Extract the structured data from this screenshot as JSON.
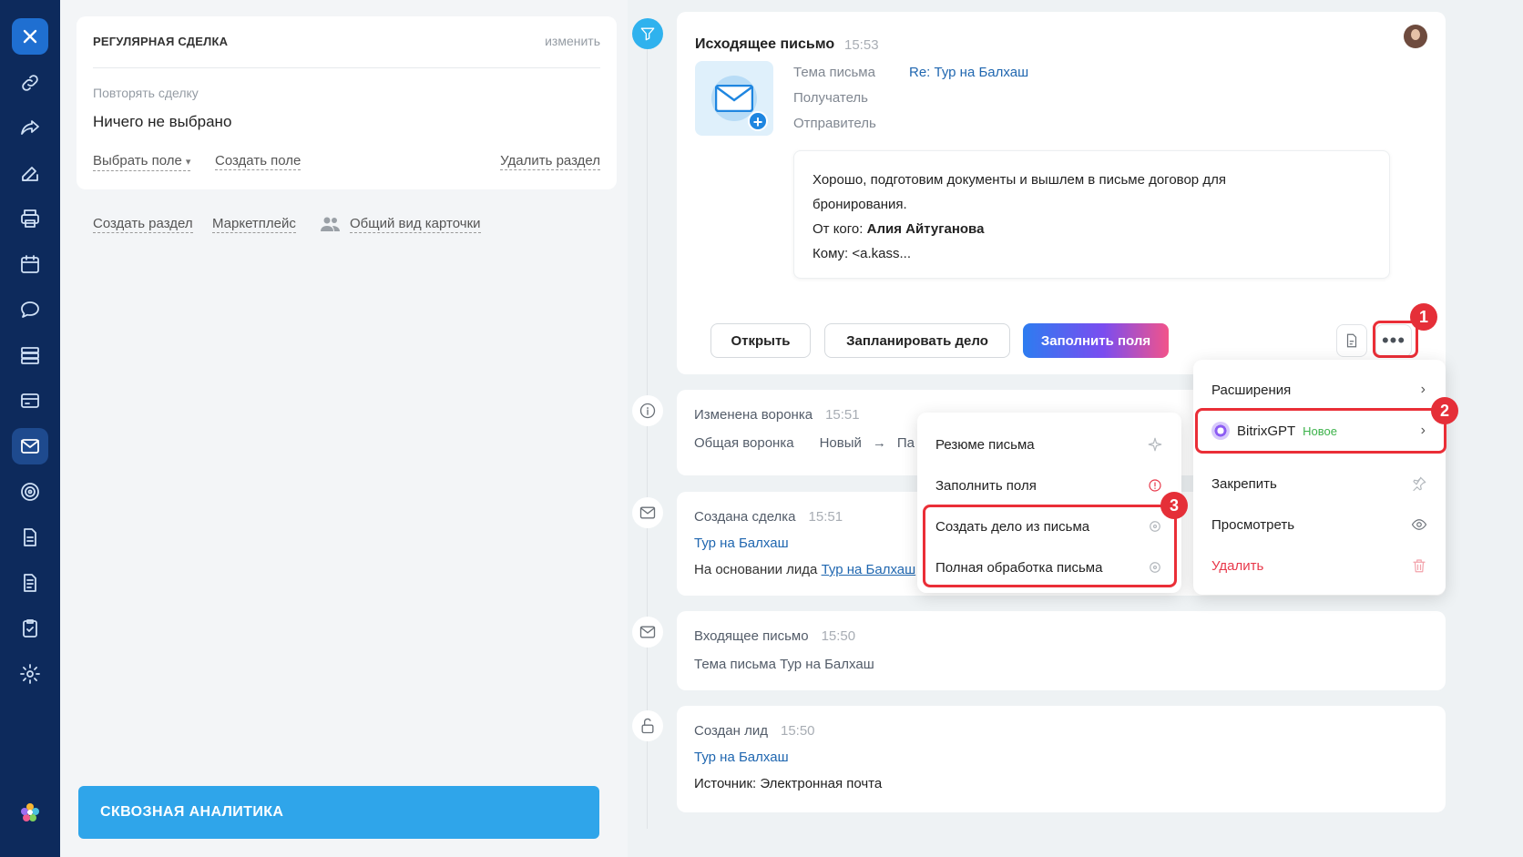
{
  "sidebar": {
    "icons": [
      "close-icon",
      "link-icon",
      "share-icon",
      "edit-icon",
      "print-icon",
      "calendar-icon",
      "chat-icon",
      "list-icon",
      "card-icon",
      "mail-icon",
      "target-icon",
      "document-icon",
      "document-lines-icon",
      "clipboard-check-icon",
      "gear-icon",
      "flower-logo-icon"
    ]
  },
  "left": {
    "section_title": "РЕГУЛЯРНАЯ СДЕЛКА",
    "change_label": "изменить",
    "repeat_label": "Повторять сделку",
    "repeat_value": "Ничего не выбрано",
    "choose_field": "Выбрать поле",
    "create_field": "Создать поле",
    "delete_section": "Удалить раздел",
    "create_section": "Создать раздел",
    "marketplace": "Маркетплейс",
    "card_view": "Общий вид карточки",
    "analytics_button": "СКВОЗНАЯ АНАЛИТИКА"
  },
  "email": {
    "title": "Исходящее письмо",
    "time": "15:53",
    "subject_label": "Тема письма",
    "subject_value": "Re: Тур на Балхаш",
    "recipient_label": "Получатель",
    "sender_label": "Отправитель",
    "body_line1": "Хорошо, подготовим документы и вышлем в письме договор для",
    "body_line2": "бронирования.",
    "from_label": "От кого: ",
    "from_value": "Алия Айтуганова",
    "to_line": "Кому: <a.kass...",
    "btn_open": "Открыть",
    "btn_schedule": "Запланировать дело",
    "btn_fill": "Заполнить поля"
  },
  "timeline": {
    "funnel": {
      "title": "Изменена воронка",
      "time": "15:51",
      "funnel_name": "Общая воронка",
      "from_stage": "Новый",
      "arrow": "→",
      "to_stage": "Па"
    },
    "deal": {
      "title": "Создана сделка",
      "time": "15:51",
      "link": "Тур на Балхаш",
      "basis_text": "На основании лида ",
      "basis_link": "Тур на Балхаш"
    },
    "incoming": {
      "title": "Входящее письмо",
      "time": "15:50",
      "subject": "Тема письма Тур на Балхаш"
    },
    "lead": {
      "title": "Создан лид",
      "time": "15:50",
      "link": "Тур на Балхаш",
      "source": "Источник: Электронная почта"
    }
  },
  "menu_main": {
    "extensions": "Расширения",
    "gpt_label": "BitrixGPT",
    "gpt_new": "Новое",
    "pin": "Закрепить",
    "view": "Просмотреть",
    "delete": "Удалить"
  },
  "menu_gpt": {
    "summary": "Резюме письма",
    "fill_fields": "Заполнить поля",
    "create_task": "Создать дело из письма",
    "full_process": "Полная обработка письма"
  },
  "badges": {
    "one": "1",
    "two": "2",
    "three": "3"
  },
  "colors": {
    "sidebar": "#0d2a5c",
    "accent_blue": "#2fa5ea",
    "link_blue": "#2067b0",
    "annotation_red": "#ea2e37",
    "new_green": "#3cb24a"
  }
}
